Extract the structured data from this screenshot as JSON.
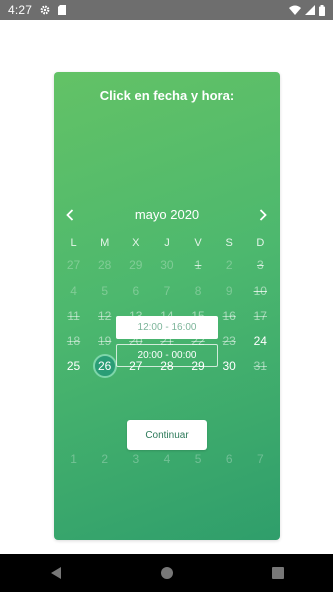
{
  "status_bar": {
    "time": "4:27",
    "icons": [
      "gear-icon",
      "sim-card-icon",
      "wifi-icon",
      "signal-icon",
      "battery-icon"
    ]
  },
  "card": {
    "title": "Click en fecha y hora:",
    "month": "mayo 2020",
    "weekdays": [
      "L",
      "M",
      "X",
      "J",
      "V",
      "S",
      "D"
    ],
    "weeks": [
      [
        {
          "label": "27",
          "state": "faint"
        },
        {
          "label": "28",
          "state": "faint"
        },
        {
          "label": "29",
          "state": "faint"
        },
        {
          "label": "30",
          "state": "faint"
        },
        {
          "label": "1",
          "state": "faint-strike"
        },
        {
          "label": "2",
          "state": "faint"
        },
        {
          "label": "3",
          "state": "faint-strike"
        }
      ],
      [
        {
          "label": "4",
          "state": "faint"
        },
        {
          "label": "5",
          "state": "faint"
        },
        {
          "label": "6",
          "state": "faint"
        },
        {
          "label": "7",
          "state": "faint"
        },
        {
          "label": "8",
          "state": "faint"
        },
        {
          "label": "9",
          "state": "faint"
        },
        {
          "label": "10",
          "state": "faint-strike"
        }
      ],
      [
        {
          "label": "11",
          "state": "strike"
        },
        {
          "label": "12",
          "state": "strike"
        },
        {
          "label": "13",
          "state": "strike"
        },
        {
          "label": "14",
          "state": "strike"
        },
        {
          "label": "15",
          "state": "strike"
        },
        {
          "label": "16",
          "state": "strike"
        },
        {
          "label": "17",
          "state": "strike"
        }
      ],
      [
        {
          "label": "18",
          "state": "strike"
        },
        {
          "label": "19",
          "state": "strike"
        },
        {
          "label": "20",
          "state": "strike"
        },
        {
          "label": "21",
          "state": "strike"
        },
        {
          "label": "22",
          "state": "strike"
        },
        {
          "label": "23",
          "state": "strike"
        },
        {
          "label": "24",
          "state": "active"
        }
      ],
      [
        {
          "label": "25",
          "state": "active"
        },
        {
          "label": "26",
          "state": "selected"
        },
        {
          "label": "27",
          "state": "active"
        },
        {
          "label": "28",
          "state": "active"
        },
        {
          "label": "29",
          "state": "active"
        },
        {
          "label": "30",
          "state": "active"
        },
        {
          "label": "31",
          "state": "strike"
        }
      ],
      [
        {
          "label": "1",
          "state": "faint"
        },
        {
          "label": "2",
          "state": "faint"
        },
        {
          "label": "3",
          "state": "faint"
        },
        {
          "label": "4",
          "state": "faint"
        },
        {
          "label": "5",
          "state": "faint"
        },
        {
          "label": "6",
          "state": "faint"
        },
        {
          "label": "7",
          "state": "faint"
        }
      ]
    ],
    "time_slots": [
      "12:00 - 16:00",
      "20:00 - 00:00"
    ],
    "continue_label": "Continuar"
  },
  "nav_bar": {
    "icons": [
      "back-icon",
      "home-icon",
      "recents-icon"
    ]
  },
  "colors": {
    "card_gradient_start": "#63c266",
    "card_gradient_end": "#2f9e6b",
    "selected_day": "#2a9d76",
    "status_bar": "#6e6e6e"
  }
}
